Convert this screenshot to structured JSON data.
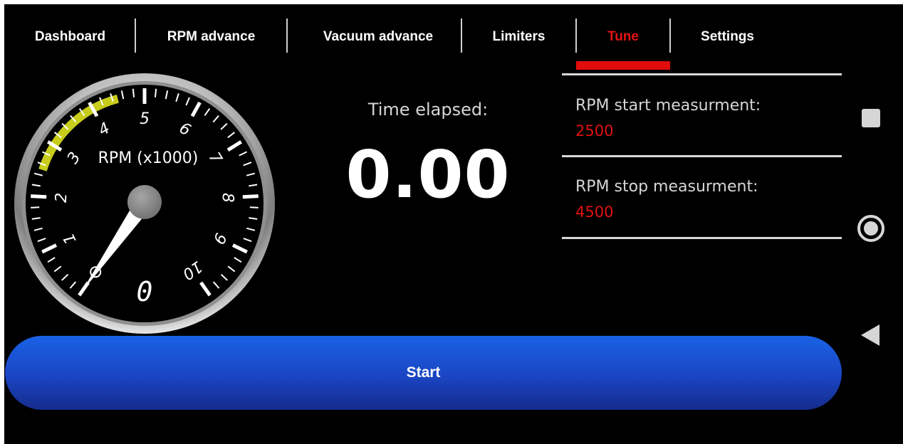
{
  "tabs": [
    {
      "label": "Dashboard",
      "active": false
    },
    {
      "label": "RPM advance",
      "active": false
    },
    {
      "label": "Vacuum advance",
      "active": false
    },
    {
      "label": "Limiters",
      "active": false
    },
    {
      "label": "Tune",
      "active": true
    },
    {
      "label": "Settings",
      "active": false
    }
  ],
  "gauge": {
    "label": "RPM (x1000)",
    "tick_labels": [
      "1",
      "2",
      "3",
      "4",
      "5",
      "6",
      "7",
      "8",
      "9",
      "10"
    ],
    "min": 0,
    "max": 10,
    "needle_value": 0,
    "readout": "0",
    "highlight_band": [
      2.5,
      4.5
    ],
    "highlight_color": "#c8cc1a",
    "face_color": "#000000",
    "tick_color": "#ffffff"
  },
  "time": {
    "label": "Time elapsed:",
    "value": "0.00"
  },
  "measurement": {
    "start_label": "RPM start measurment:",
    "start_value": "2500",
    "stop_label": "RPM stop measurment:",
    "stop_value": "4500"
  },
  "start_button": {
    "label": "Start"
  },
  "nav": {
    "recents": "square-icon",
    "home": "circle-icon",
    "back": "triangle-back-icon"
  },
  "colors": {
    "accent_red": "#e31212",
    "button_blue": "#1a45c3",
    "background": "#000000"
  }
}
